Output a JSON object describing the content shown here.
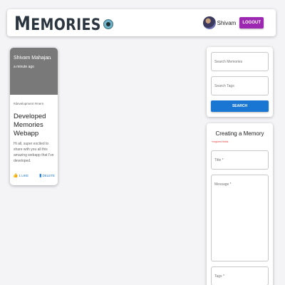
{
  "header": {
    "brand_cap": "M",
    "brand_rest": "EMORIES",
    "username": "Shivam",
    "logout_label": "LOGOUT"
  },
  "post": {
    "author": "Shivam Mahajan",
    "time": "a minute ago",
    "more": "...",
    "tags": "#development #mern",
    "title": "Developed Memories Webapp",
    "message": "Hi all, super excited to share with you all this amazing webapp that I've developed.",
    "like_label": "1 LIKE",
    "delete_label": "DELETE",
    "thumb_icon": "thumb-up-icon",
    "trash_icon": "delete-icon"
  },
  "search": {
    "memories_placeholder": "Search Memories",
    "tags_placeholder": "Search Tags",
    "button_label": "SEARCH"
  },
  "form": {
    "title": "Creating a Memory",
    "required_note": "*required fields",
    "title_label": "Title *",
    "message_label": "Message *",
    "tags_label": "Tags *"
  },
  "colors": {
    "primary": "#1976d2",
    "logout": "#9c27b0",
    "media_bg": "#797979",
    "required": "#e53935"
  }
}
